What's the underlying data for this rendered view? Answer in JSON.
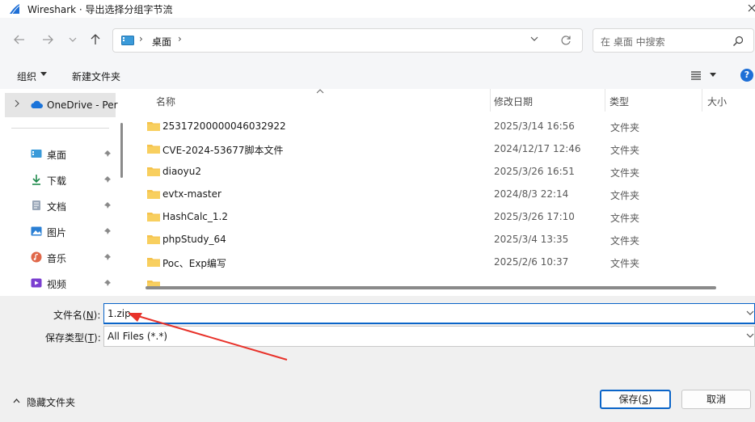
{
  "titlebar": {
    "title": "Wireshark · 导出选择分组字节流"
  },
  "address": {
    "crumb": "桌面",
    "search_placeholder": "在 桌面 中搜索"
  },
  "toolbar": {
    "organize": "组织",
    "new_folder": "新建文件夹",
    "help": "?"
  },
  "sidebar": {
    "onedrive": "OneDrive - Per",
    "items": [
      {
        "label": "桌面",
        "icon": "desktop-icon"
      },
      {
        "label": "下载",
        "icon": "download-icon"
      },
      {
        "label": "文档",
        "icon": "document-icon"
      },
      {
        "label": "图片",
        "icon": "pictures-icon"
      },
      {
        "label": "音乐",
        "icon": "music-icon"
      },
      {
        "label": "视频",
        "icon": "video-icon"
      }
    ]
  },
  "columns": {
    "name": "名称",
    "date": "修改日期",
    "type": "类型",
    "size": "大小"
  },
  "files": [
    {
      "name": "25317200000046032922",
      "date": "2025/3/14 16:56",
      "type": "文件夹"
    },
    {
      "name": "CVE-2024-53677脚本文件",
      "date": "2024/12/17 12:46",
      "type": "文件夹"
    },
    {
      "name": "diaoyu2",
      "date": "2025/3/26 16:51",
      "type": "文件夹"
    },
    {
      "name": "evtx-master",
      "date": "2024/8/3 22:14",
      "type": "文件夹"
    },
    {
      "name": "HashCalc_1.2",
      "date": "2025/3/26 17:10",
      "type": "文件夹"
    },
    {
      "name": "phpStudy_64",
      "date": "2025/3/4 13:35",
      "type": "文件夹"
    },
    {
      "name": "Poc、Exp编写",
      "date": "2025/2/6 10:37",
      "type": "文件夹"
    }
  ],
  "form": {
    "filename_label": "文件名(",
    "filename_key": "N",
    "filename_label_end": "):",
    "filename_value": "1.zip",
    "filetype_label": "保存类型(",
    "filetype_key": "T",
    "filetype_label_end": "):",
    "filetype_value": "All Files (*.*)"
  },
  "footer": {
    "hide_folders": "隐藏文件夹",
    "save_label": "保存(",
    "save_key": "S",
    "save_end": ")",
    "cancel_label": "取消"
  },
  "colors": {
    "accent": "#0a64c8",
    "folder": "#f5c24b",
    "annotation": "#e8322a"
  }
}
